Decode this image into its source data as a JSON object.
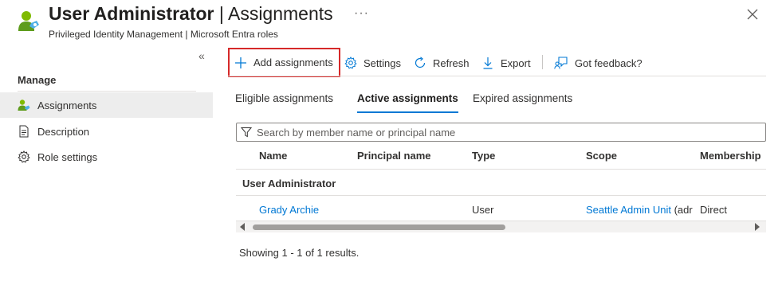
{
  "header": {
    "title_main": "User Administrator",
    "title_sep": " | ",
    "title_section": "Assignments",
    "more": "···",
    "subtitle": "Privileged Identity Management | Microsoft Entra roles",
    "icon": "user-role-icon",
    "close_icon": "close-icon"
  },
  "sidebar": {
    "collapse": "«",
    "section_label": "Manage",
    "items": [
      {
        "label": "Assignments",
        "icon": "users-icon",
        "active": true
      },
      {
        "label": "Description",
        "icon": "document-icon",
        "active": false
      },
      {
        "label": "Role settings",
        "icon": "gear-icon",
        "active": false
      }
    ]
  },
  "toolbar": {
    "add_assignments": "Add assignments",
    "settings": "Settings",
    "refresh": "Refresh",
    "export": "Export",
    "feedback": "Got feedback?"
  },
  "tabs": [
    {
      "label": "Eligible assignments",
      "active": false
    },
    {
      "label": "Active assignments",
      "active": true
    },
    {
      "label": "Expired assignments",
      "active": false
    }
  ],
  "search": {
    "placeholder": "Search by member name or principal name",
    "value": ""
  },
  "table": {
    "columns": [
      "Name",
      "Principal name",
      "Type",
      "Scope",
      "Membership"
    ],
    "group": "User Administrator",
    "rows": [
      {
        "name": "Grady Archie",
        "principal_name": "",
        "type": "User",
        "scope": "Seattle Admin Unit",
        "scope_suffix": " (adr",
        "membership": "Direct"
      }
    ]
  },
  "results_text": "Showing 1 - 1 of 1 results.",
  "colors": {
    "accent": "#0078d4",
    "highlight_border": "#d62929",
    "active_nav_bg": "#ededed"
  }
}
